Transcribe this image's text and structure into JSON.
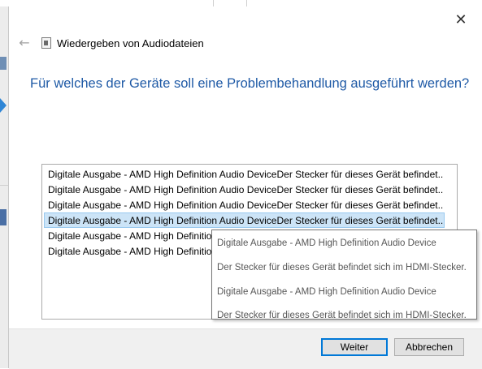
{
  "dialog": {
    "close_glyph": "✕",
    "back_glyph": "←",
    "title": "Wiedergeben von Audiodateien",
    "title_icon": "troubleshooter-icon",
    "heading": "Für welches der Geräte soll eine Problembehandlung ausgeführt werden?"
  },
  "devices": [
    {
      "label": "Digitale Ausgabe - AMD High Definition Audio DeviceDer Stecker für dieses Gerät befindet..."
    },
    {
      "label": "Digitale Ausgabe - AMD High Definition Audio DeviceDer Stecker für dieses Gerät befindet..."
    },
    {
      "label": "Digitale Ausgabe - AMD High Definition Audio DeviceDer Stecker für dieses Gerät befindet..."
    },
    {
      "label": "Digitale Ausgabe - AMD High Definition Audio DeviceDer Stecker für dieses Gerät befindet...",
      "selected": true
    },
    {
      "label": "Digitale Ausgabe - AMD High Definition"
    },
    {
      "label": "Digitale Ausgabe - AMD High Definition"
    }
  ],
  "tooltip": {
    "line1": "Digitale Ausgabe - AMD High Definition Audio Device",
    "line2": "Der Stecker für dieses Gerät befindet sich im HDMI-Stecker.",
    "line3": "Digitale Ausgabe - AMD High Definition Audio Device",
    "line4": "Der Stecker für dieses Gerät befindet sich im HDMI-Stecker."
  },
  "buttons": {
    "next": "Weiter",
    "cancel": "Abbrechen"
  },
  "colors": {
    "heading": "#1f5aa6",
    "selection": "#cce4f7",
    "default_button_border": "#0078d7"
  }
}
